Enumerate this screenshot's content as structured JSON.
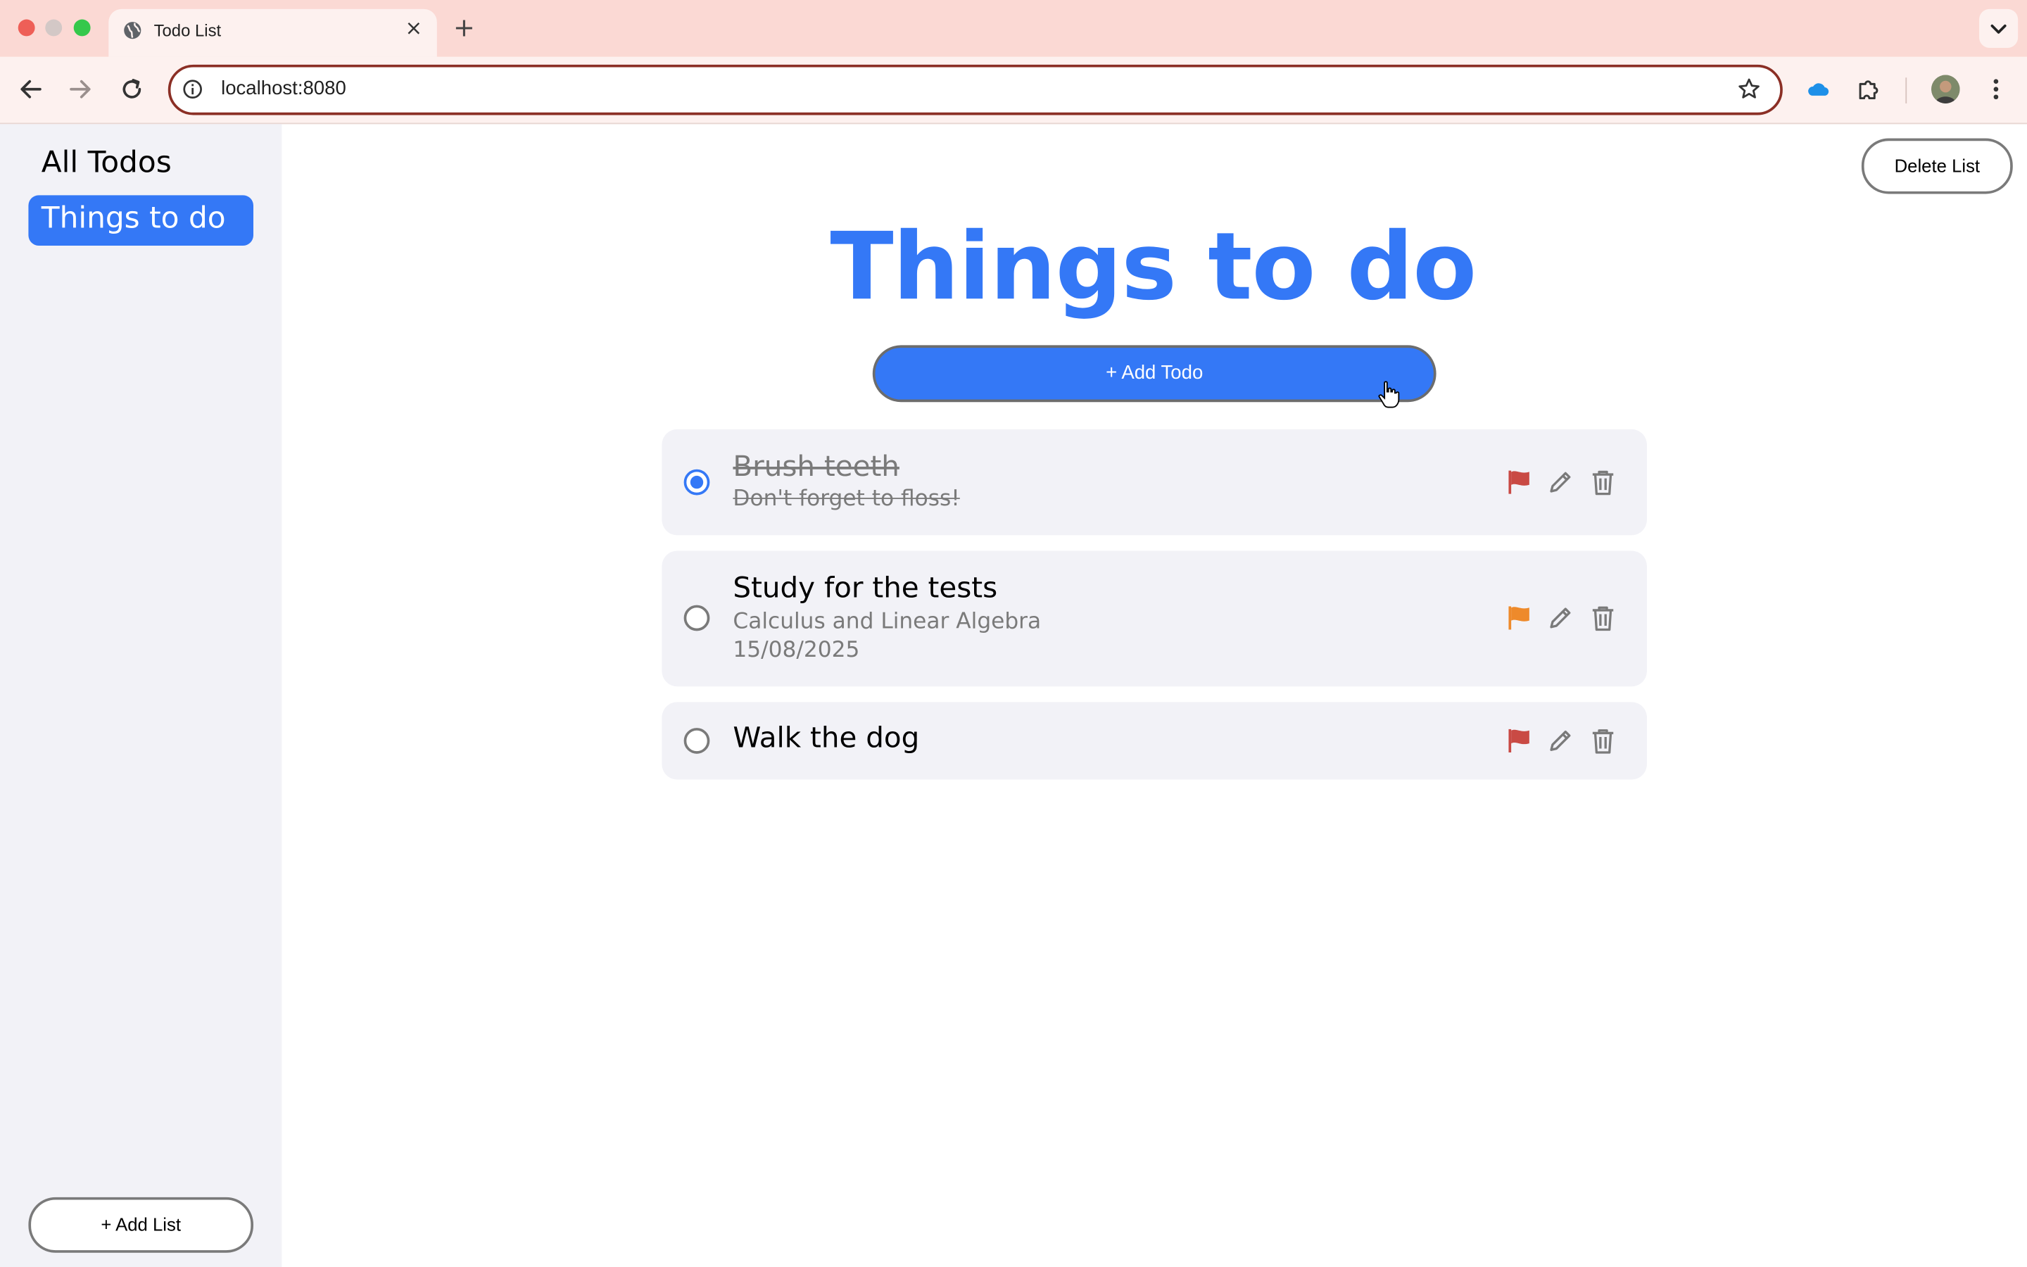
{
  "browser": {
    "tab_title": "Todo List",
    "url": "localhost:8080",
    "tab_close_glyph": "×",
    "new_tab_glyph": "+",
    "icons": [
      "globe-icon",
      "back-icon",
      "forward-icon",
      "reload-icon",
      "info-icon",
      "star-icon",
      "cloud-icon",
      "puzzle-icon",
      "kebab-icon",
      "chevron-down-icon"
    ]
  },
  "sidebar": {
    "all_label": "All Todos",
    "lists": [
      {
        "label": "Things to do",
        "active": true
      }
    ],
    "add_list_label": "+ Add List"
  },
  "header": {
    "delete_list_label": "Delete List",
    "title": "Things to do",
    "add_todo_label": "+ Add Todo"
  },
  "todos": [
    {
      "title": "Brush teeth",
      "notes": "Don't forget to floss!",
      "date": "",
      "completed": true,
      "flag_color": "#c94a44"
    },
    {
      "title": "Study for the tests",
      "notes": "Calculus and Linear Algebra",
      "date": "15/08/2025",
      "completed": false,
      "flag_color": "#ee8a2b"
    },
    {
      "title": "Walk the dog",
      "notes": "",
      "date": "",
      "completed": false,
      "flag_color": "#c94a44"
    }
  ],
  "colors": {
    "accent": "#3478f6",
    "sidebar_bg": "#f2f2f7",
    "chrome_bg": "#fbd9d4"
  }
}
